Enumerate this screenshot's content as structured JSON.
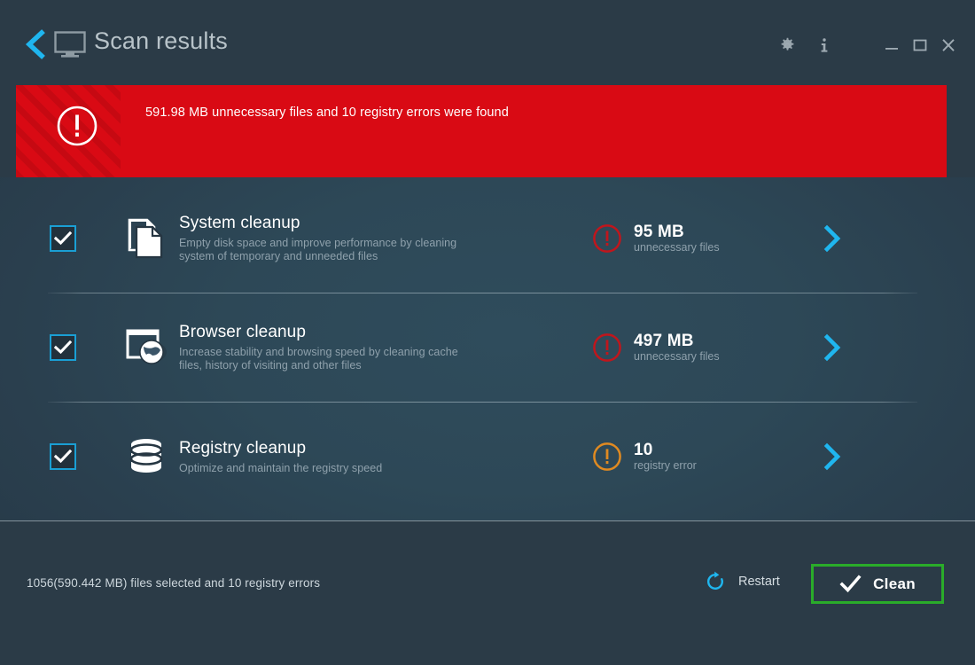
{
  "header": {
    "back_icon": "chevron-left-icon",
    "monitor_icon": "monitor-icon",
    "title": "Scan results",
    "gear_icon": "gear-icon",
    "info_icon": "info-icon",
    "minimize_icon": "minimize-icon",
    "maximize_icon": "maximize-icon",
    "close_icon": "close-icon"
  },
  "alert": {
    "icon": "exclamation-circle-icon",
    "message": "591.98 MB unnecessary files and 10 registry errors were found",
    "bg_color": "#d90a14",
    "text_color": "#ffffff"
  },
  "rows": [
    {
      "checked": true,
      "icon": "documents-icon",
      "title": "System cleanup",
      "desc_line1": "Empty disk space and improve performance by cleaning",
      "desc_line2": "system of temporary and unneeded files",
      "status_icon": "exclamation-circle-icon",
      "status_color": "#c0161c",
      "value": "95 MB",
      "sub": "unnecessary files",
      "chevron": "chevron-right-icon"
    },
    {
      "checked": true,
      "icon": "browser-globe-icon",
      "title": "Browser cleanup",
      "desc_line1": "Increase stability and browsing speed by cleaning cache",
      "desc_line2": "files, history of visiting and other files",
      "status_icon": "exclamation-circle-icon",
      "status_color": "#c0161c",
      "value": "497 MB",
      "sub": "unnecessary files",
      "chevron": "chevron-right-icon"
    },
    {
      "checked": true,
      "icon": "database-icon",
      "title": "Registry cleanup",
      "desc_line1": "Optimize and maintain the registry speed",
      "desc_line2": "",
      "status_icon": "exclamation-circle-icon",
      "status_color": "#e08a21",
      "value": "10",
      "sub": "registry error",
      "chevron": "chevron-right-icon"
    }
  ],
  "footer": {
    "summary": "1056(590.442 MB) files selected and 10 registry errors",
    "restart_icon": "refresh-icon",
    "restart_label": "Restart",
    "clean_check_icon": "check-icon",
    "clean_label": "Clean",
    "clean_border_color": "#2aac2a"
  },
  "theme": {
    "window_bg": "#2b3b47",
    "content_bg": "#2d4857",
    "accent_blue": "#1fb6ef",
    "muted_text": "#8fa1ac"
  }
}
